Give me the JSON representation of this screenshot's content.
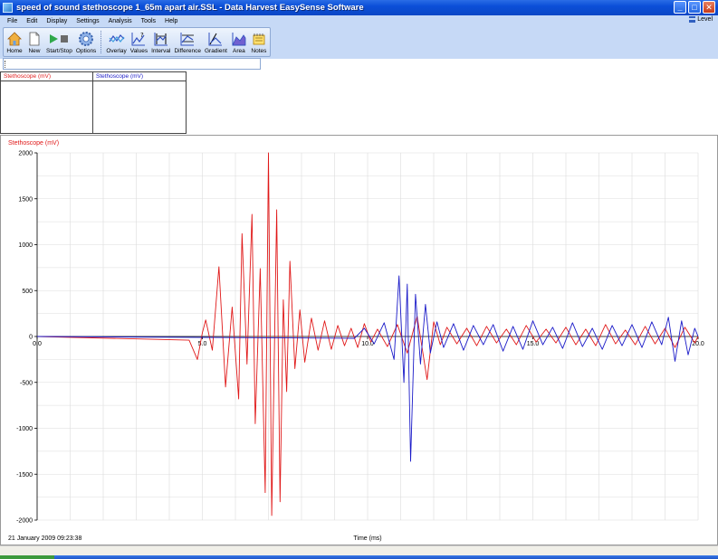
{
  "window": {
    "title": "speed of sound stethoscope 1_65m apart air.SSL - Data Harvest EasySense Software",
    "controls": [
      "_",
      "□",
      "✕"
    ]
  },
  "menu": {
    "items": [
      "File",
      "Edit",
      "Display",
      "Settings",
      "Analysis",
      "Tools",
      "Help"
    ],
    "level_label": "Level"
  },
  "toolbar": {
    "group1": [
      {
        "label": "Home",
        "icon": "home-icon"
      },
      {
        "label": "New",
        "icon": "new-document-icon"
      },
      {
        "label": "Start/Stop",
        "icon": "start-stop-icon"
      },
      {
        "label": "Options",
        "icon": "options-gear-icon"
      }
    ],
    "group2": [
      {
        "label": "Overlay",
        "icon": "overlay-icon"
      },
      {
        "label": "Values",
        "icon": "values-icon"
      },
      {
        "label": "Interval",
        "icon": "interval-icon"
      },
      {
        "label": "Difference",
        "icon": "difference-icon"
      },
      {
        "label": "Gradient",
        "icon": "gradient-icon"
      },
      {
        "label": "Area",
        "icon": "area-icon"
      },
      {
        "label": "Notes",
        "icon": "notes-icon"
      }
    ]
  },
  "meters": [
    {
      "label": "Stethoscope (mV)",
      "color": "#e02020"
    },
    {
      "label": "Stethoscope (mV)",
      "color": "#2020c8"
    }
  ],
  "graph": {
    "date_time": "21 January 2009  09:23:38"
  },
  "colors": {
    "channel1": "#e01818",
    "channel2": "#1a1ac8",
    "titlebar": "#0b4fd8",
    "menubar": "#c6d9f6"
  },
  "chart_data": {
    "type": "line",
    "title": "",
    "ylabel": "Stethoscope (mV)",
    "xlabel": "Time (ms)",
    "xlim": [
      0,
      20
    ],
    "ylim": [
      -2000,
      2000
    ],
    "x_ticks": [
      0.0,
      5.0,
      10.0,
      15.0,
      20.0
    ],
    "x_tick_labels": [
      "0.0",
      "5.0",
      "10.0",
      "15.0",
      "20.0"
    ],
    "y_ticks": [
      2000,
      1500,
      1000,
      500,
      0,
      -500,
      -1000,
      -1500,
      -2000
    ],
    "y_tick_labels": [
      "2000",
      "1500",
      "1000",
      "500",
      "0",
      "-500",
      "-1000",
      "-1500",
      "-2000"
    ],
    "grid": true,
    "series": [
      {
        "color": "#e01818",
        "x": [
          0,
          4.6,
          4.85,
          5.0,
          5.1,
          5.3,
          5.5,
          5.7,
          5.9,
          6.1,
          6.2,
          6.35,
          6.5,
          6.6,
          6.75,
          6.9,
          7.0,
          7.1,
          7.25,
          7.35,
          7.45,
          7.55,
          7.65,
          7.8,
          7.95,
          8.1,
          8.3,
          8.5,
          8.7,
          8.9,
          9.1,
          9.3,
          9.5,
          9.7,
          9.9,
          10.1,
          10.3,
          10.6,
          10.9,
          11.2,
          11.5,
          11.8,
          12.0,
          12.2,
          12.4,
          12.7,
          13.0,
          13.3,
          13.6,
          13.9,
          14.2,
          14.5,
          14.8,
          15.1,
          15.4,
          15.7,
          16.0,
          16.3,
          16.6,
          16.9,
          17.2,
          17.5,
          17.8,
          18.1,
          18.4,
          18.7,
          19.0,
          19.3,
          19.6,
          19.9,
          20.0
        ],
        "y": [
          0,
          -40,
          -250,
          40,
          180,
          -150,
          760,
          -550,
          320,
          -680,
          1120,
          -300,
          1330,
          -950,
          740,
          -1700,
          2000,
          -1950,
          1380,
          -1800,
          400,
          -600,
          820,
          -350,
          290,
          -280,
          200,
          -150,
          170,
          -140,
          120,
          -100,
          90,
          -120,
          140,
          -60,
          80,
          -110,
          130,
          -180,
          220,
          -470,
          160,
          -90,
          100,
          -80,
          90,
          -100,
          110,
          -70,
          80,
          -90,
          120,
          -60,
          80,
          -70,
          100,
          -90,
          80,
          -100,
          130,
          -80,
          70,
          -90,
          110,
          -80,
          90,
          -120,
          100,
          -70,
          0
        ]
      },
      {
        "color": "#1a1ac8",
        "x": [
          0,
          9.6,
          9.9,
          10.2,
          10.5,
          10.8,
          10.95,
          11.1,
          11.2,
          11.3,
          11.45,
          11.6,
          11.75,
          11.9,
          12.1,
          12.3,
          12.6,
          12.9,
          13.2,
          13.5,
          13.8,
          14.1,
          14.4,
          14.7,
          15.0,
          15.3,
          15.6,
          15.9,
          16.2,
          16.5,
          16.8,
          17.1,
          17.4,
          17.7,
          18.0,
          18.3,
          18.6,
          18.9,
          19.1,
          19.3,
          19.5,
          19.7,
          19.9,
          20.0
        ],
        "y": [
          0,
          -20,
          90,
          -80,
          150,
          -250,
          660,
          -500,
          570,
          -1360,
          460,
          -300,
          350,
          -180,
          160,
          -120,
          140,
          -150,
          120,
          -90,
          130,
          -160,
          110,
          -140,
          170,
          -90,
          100,
          -130,
          150,
          -110,
          90,
          -140,
          120,
          -100,
          130,
          -120,
          160,
          -90,
          210,
          -270,
          170,
          -200,
          90,
          0
        ]
      }
    ]
  }
}
